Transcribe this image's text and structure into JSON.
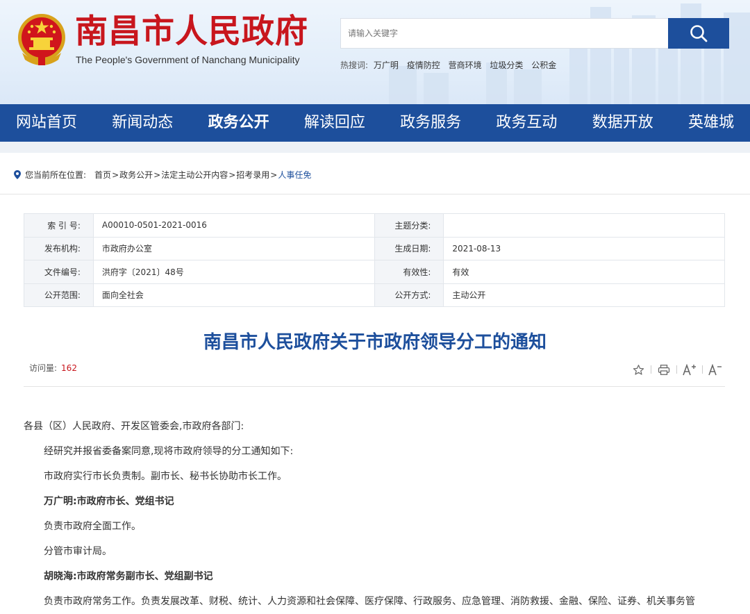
{
  "header": {
    "title": "南昌市人民政府",
    "subtitle": "The People's Government of Nanchang Municipality",
    "search_placeholder": "请输入关键字",
    "hot_label": "热搜词:",
    "hot_words": [
      "万广明",
      "疫情防控",
      "营商环境",
      "垃圾分类",
      "公积金"
    ]
  },
  "nav": {
    "items": [
      "网站首页",
      "新闻动态",
      "政务公开",
      "解读回应",
      "政务服务",
      "政务互动",
      "数据开放",
      "英雄城"
    ],
    "active": "政务公开"
  },
  "breadcrumb": {
    "label": "您当前所在位置:",
    "items": [
      "首页",
      "政务公开",
      "法定主动公开内容",
      "招考录用",
      "人事任免"
    ]
  },
  "meta": {
    "rows": [
      [
        {
          "k": "索 引 号:",
          "v": "A00010-0501-2021-0016"
        },
        {
          "k": "主题分类:",
          "v": ""
        }
      ],
      [
        {
          "k": "发布机构:",
          "v": "市政府办公室"
        },
        {
          "k": "生成日期:",
          "v": "2021-08-13"
        }
      ],
      [
        {
          "k": "文件编号:",
          "v": "洪府字〔2021〕48号"
        },
        {
          "k": "有效性:",
          "v": "有效"
        }
      ],
      [
        {
          "k": "公开范围:",
          "v": "面向全社会"
        },
        {
          "k": "公开方式:",
          "v": "主动公开"
        }
      ]
    ]
  },
  "article": {
    "title": "南昌市人民政府关于市政府领导分工的通知",
    "visits_label": "访问量:",
    "visits": "162",
    "paragraphs": [
      {
        "text": "各县（区）人民政府、开发区管委会,市政府各部门:",
        "indent": false,
        "bold": false
      },
      {
        "text": "经研究并报省委备案同意,现将市政府领导的分工通知如下:",
        "indent": true,
        "bold": false
      },
      {
        "text": "市政府实行市长负责制。副市长、秘书长协助市长工作。",
        "indent": true,
        "bold": false
      },
      {
        "text": "万广明:市政府市长、党组书记",
        "indent": true,
        "bold": true
      },
      {
        "text": "负责市政府全面工作。",
        "indent": true,
        "bold": false
      },
      {
        "text": "分管市审计局。",
        "indent": true,
        "bold": false
      },
      {
        "text": "胡晓海:市政府常务副市长、党组副书记",
        "indent": true,
        "bold": true
      },
      {
        "text": "负责市政府常务工作。负责发展改革、财税、统计、人力资源和社会保障、医疗保障、行政服务、应急管理、消防救援、金融、保险、证券、机关事务管",
        "indent": true,
        "bold": false
      }
    ]
  },
  "colors": {
    "brand_red": "#c8161d",
    "nav_blue": "#1d4f9c"
  },
  "icons": [
    "national-emblem-icon",
    "search-icon",
    "location-pin-icon",
    "star-icon",
    "print-icon",
    "font-larger-icon",
    "font-smaller-icon"
  ]
}
